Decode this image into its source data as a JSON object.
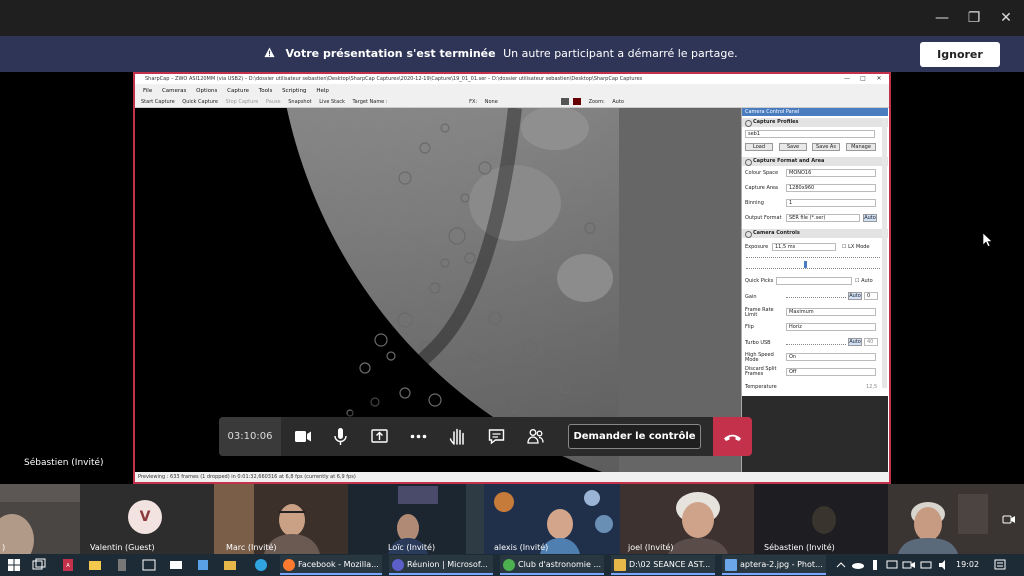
{
  "window": {
    "minimize": "—",
    "restore": "❐",
    "close": "✕"
  },
  "banner": {
    "title": "Votre présentation s'est terminée",
    "message": "Un autre participant a démarré le partage.",
    "ignore_label": "Ignorer"
  },
  "sharpcap": {
    "title": "SharpCap – ZWO ASI120MM (via USB2) – D:\\dossier utilisateur sebastien\\Desktop\\SharpCap Captures\\2020-12-19\\Capture\\19_01_01.ser – D:\\dossier utilisateur sebastien\\Desktop\\SharpCap Captures",
    "menu": [
      "File",
      "Cameras",
      "Options",
      "Capture",
      "Tools",
      "Scripting",
      "Help"
    ],
    "toolbar": {
      "start": "Start Capture",
      "quick": "Quick Capture",
      "stop": "Stop Capture",
      "pause": "Pause",
      "snapshot": "Snapshot",
      "live": "Live Stack",
      "target": "Target Name :",
      "fx": "FX:",
      "fx_value": "None",
      "zoom": "Zoom:",
      "zoom_value": "Auto"
    },
    "panel": {
      "title": "Camera Control Panel",
      "profiles": {
        "header": "Capture Profiles",
        "value": "seb1",
        "load": "Load",
        "save": "Save",
        "save_as": "Save As",
        "manage": "Manage"
      },
      "format": {
        "header": "Capture Format and Area",
        "colour_label": "Colour Space",
        "colour_value": "MONO16",
        "area_label": "Capture Area",
        "area_value": "1280x960",
        "binning_label": "Binning",
        "binning_value": "1",
        "output_label": "Output Format",
        "output_value": "SER file (*.ser)",
        "auto": "Auto"
      },
      "controls": {
        "header": "Camera Controls",
        "exposure_label": "Exposure",
        "exposure_value": "11,5 ms",
        "lx": "LX Mode",
        "quick_picks": "Quick Picks",
        "auto": "Auto",
        "gain_label": "Gain",
        "gain_auto": "Auto",
        "gain_value": "0",
        "frame_rate_label": "Frame Rate Limit",
        "frame_rate_value": "Maximum",
        "flip_label": "Flip",
        "flip_value": "Horiz",
        "turbo_label": "Turbo USB",
        "turbo_auto": "Auto",
        "turbo_value": "40",
        "highspeed_label": "High Speed Mode",
        "highspeed_value": "On",
        "discard_label": "Discard Split Frames",
        "discard_value": "Off",
        "temperature_label": "Temperature",
        "temperature_value": "12,5"
      }
    },
    "status": "Previewing : 633 frames (1 dropped) in 0:01:32,660316 at 6,8 fps  (currently at 6,9 fps)"
  },
  "presenter": "Sébastien (Invité)",
  "callbar": {
    "timer": "03:10:06",
    "control": "Demander le contrôle"
  },
  "participants": [
    {
      "name": ")",
      "initial": ""
    },
    {
      "name": "Valentin (Guest)",
      "initial": "V"
    },
    {
      "name": "Marc (Invité)",
      "initial": ""
    },
    {
      "name": "Loïc (Invité)",
      "initial": ""
    },
    {
      "name": "alexis (Invité)",
      "initial": ""
    },
    {
      "name": "joel (Invité)",
      "initial": ""
    },
    {
      "name": "Sébastien (Invité)",
      "initial": ""
    },
    {
      "name": "",
      "initial": ""
    }
  ],
  "taskbar": {
    "apps": [
      "Facebook - Mozilla...",
      "Réunion | Microsof...",
      "Club d'astronomie ...",
      "D:\\02 SEANCE AST...",
      "aptera-2.jpg - Phot..."
    ],
    "time": "19:02"
  }
}
